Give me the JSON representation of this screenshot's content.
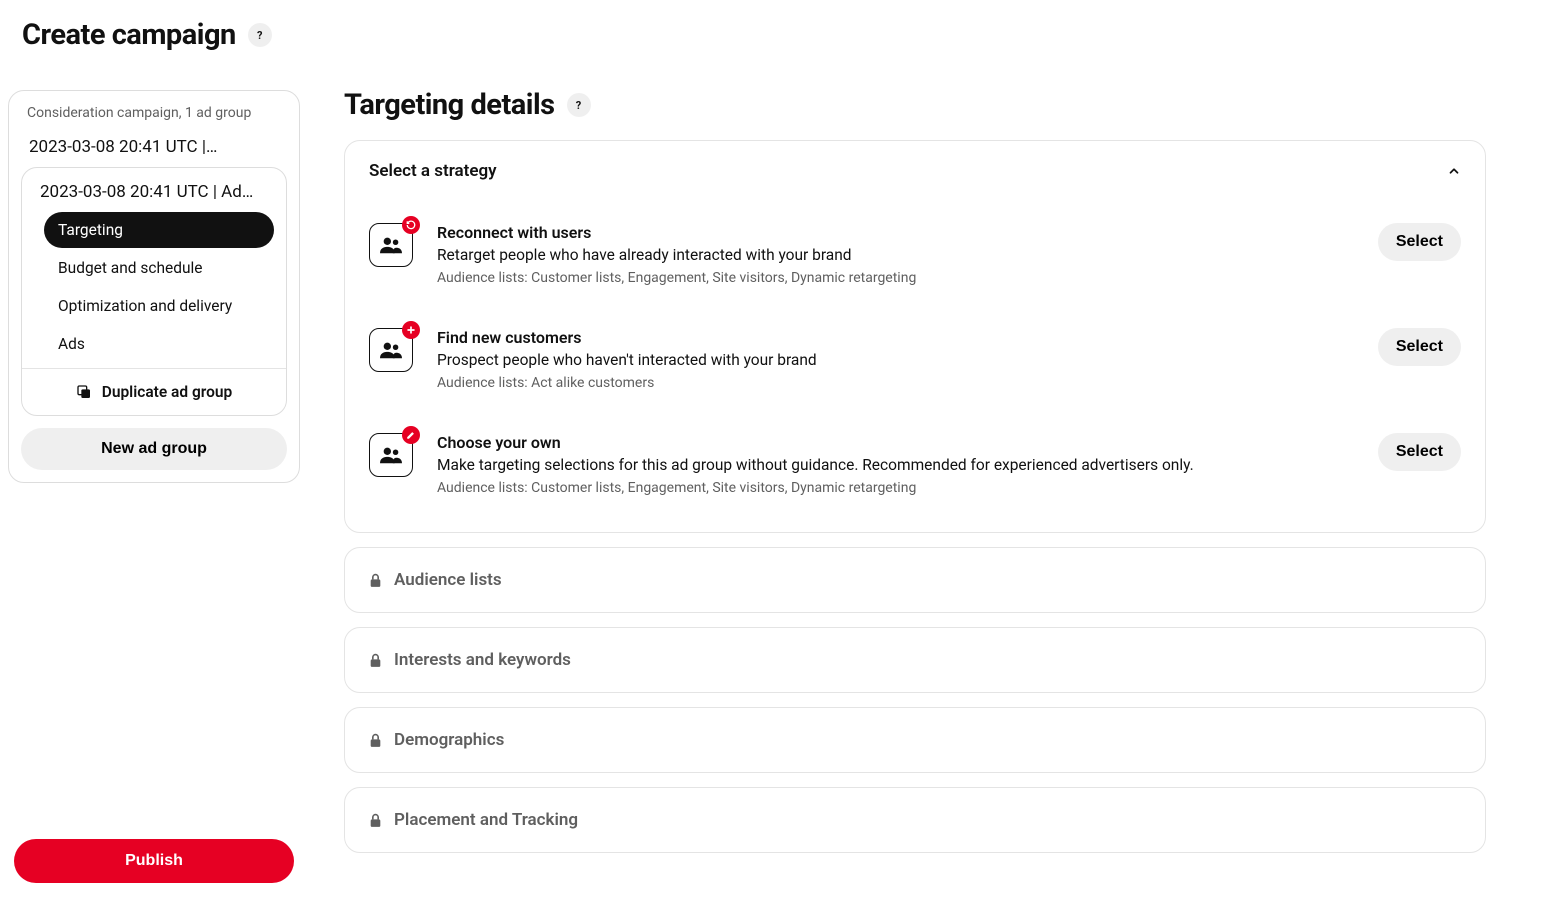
{
  "header": {
    "title": "Create campaign"
  },
  "sidebar": {
    "summary": "Consideration campaign, 1 ad group",
    "campaign_title": "2023-03-08 20:41 UTC |…",
    "adgroup_title": "2023-03-08 20:41 UTC | Ad…",
    "nav": [
      {
        "label": "Targeting",
        "active": true
      },
      {
        "label": "Budget and schedule",
        "active": false
      },
      {
        "label": "Optimization and delivery",
        "active": false
      },
      {
        "label": "Ads",
        "active": false
      }
    ],
    "duplicate_label": "Duplicate ad group",
    "new_adgroup_label": "New ad group",
    "publish_label": "Publish"
  },
  "main": {
    "title": "Targeting details",
    "strategy_card": {
      "title": "Select a strategy",
      "expanded": true,
      "select_label": "Select",
      "strategies": [
        {
          "badge": "reconnect",
          "title": "Reconnect with users",
          "desc": "Retarget people who have already interacted with your brand",
          "meta": "Audience lists: Customer lists, Engagement, Site visitors, Dynamic retargeting"
        },
        {
          "badge": "new",
          "title": "Find new customers",
          "desc": "Prospect people who haven't interacted with your brand",
          "meta": "Audience lists: Act alike customers"
        },
        {
          "badge": "custom",
          "title": "Choose your own",
          "desc": "Make targeting selections for this ad group without guidance. Recommended for experienced advertisers only.",
          "meta": "Audience lists: Customer lists, Engagement, Site visitors, Dynamic retargeting"
        }
      ]
    },
    "locked_sections": [
      {
        "title": "Audience lists"
      },
      {
        "title": "Interests and keywords"
      },
      {
        "title": "Demographics"
      },
      {
        "title": "Placement and Tracking"
      }
    ]
  }
}
